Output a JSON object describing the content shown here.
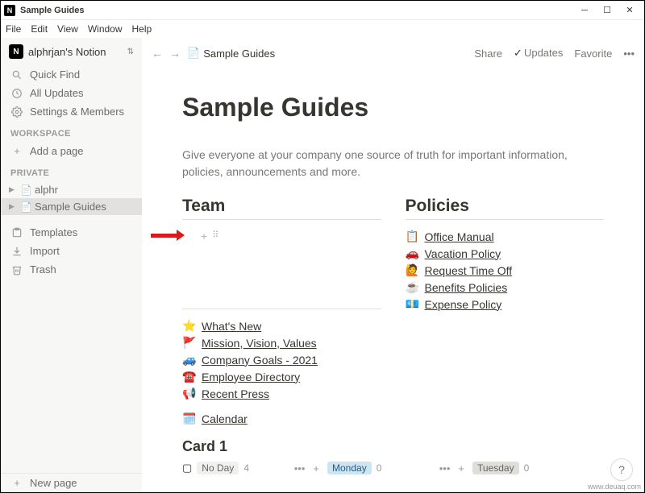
{
  "window": {
    "title": "Sample Guides"
  },
  "menubar": [
    "File",
    "Edit",
    "View",
    "Window",
    "Help"
  ],
  "sidebar": {
    "workspace_name": "alphrjan's Notion",
    "quick_find": "Quick Find",
    "all_updates": "All Updates",
    "settings": "Settings & Members",
    "section_workspace": "WORKSPACE",
    "add_page": "Add a page",
    "section_private": "PRIVATE",
    "private_pages": [
      {
        "label": "alphr"
      },
      {
        "label": "Sample Guides",
        "selected": true
      }
    ],
    "templates": "Templates",
    "import": "Import",
    "trash": "Trash",
    "new_page": "New page"
  },
  "topbar": {
    "breadcrumb": "Sample Guides",
    "share": "Share",
    "updates": "Updates",
    "favorite": "Favorite"
  },
  "page": {
    "title": "Sample Guides",
    "description": "Give everyone at your company one source of truth for important information, policies, announcements and more.",
    "col_team": "Team",
    "col_policies": "Policies",
    "team_links": [
      {
        "icon": "⭐",
        "label": "What's New"
      },
      {
        "icon": "🚩",
        "label": "Mission, Vision, Values"
      },
      {
        "icon": "🚙",
        "label": "Company Goals - 2021"
      },
      {
        "icon": "☎️",
        "label": "Employee Directory"
      },
      {
        "icon": "📢",
        "label": "Recent Press"
      }
    ],
    "calendar_label": "Calendar",
    "policy_links": [
      {
        "icon": "📋",
        "label": "Office Manual"
      },
      {
        "icon": "🚗",
        "label": "Vacation Policy"
      },
      {
        "icon": "🙋",
        "label": "Request Time Off"
      },
      {
        "icon": "☕",
        "label": "Benefits Policies"
      },
      {
        "icon": "💶",
        "label": "Expense Policy"
      }
    ],
    "board_title": "Card 1",
    "board_cols": [
      {
        "tag": "No Day",
        "count": "4",
        "cls": "noday",
        "has_icon": true
      },
      {
        "tag": "Monday",
        "count": "0",
        "cls": "mon"
      },
      {
        "tag": "Tuesday",
        "count": "0",
        "cls": "tue"
      }
    ]
  },
  "help": "?",
  "watermark": "www.deuaq.com"
}
